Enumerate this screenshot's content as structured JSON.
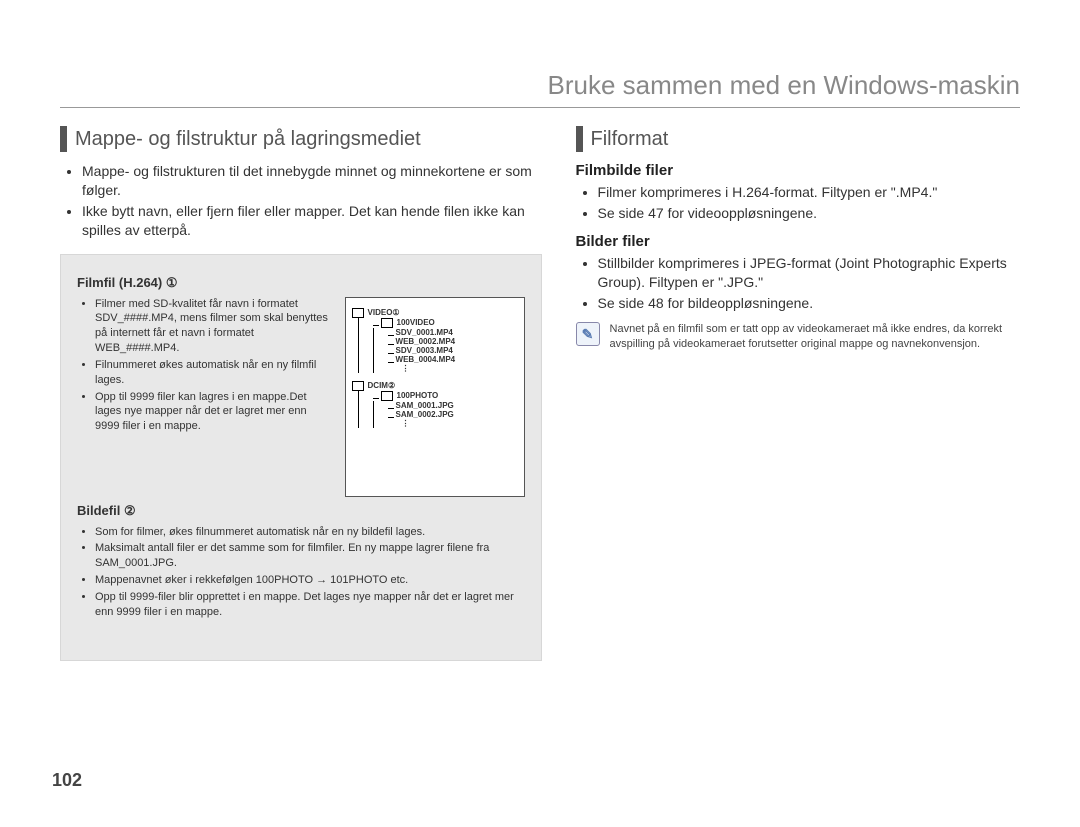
{
  "header": {
    "title": "Bruke sammen med en Windows-maskin"
  },
  "left": {
    "title": "Mappe- og filstruktur på lagringsmediet",
    "bullets": [
      "Mappe- og filstrukturen til det innebygde minnet og minnekortene er som følger.",
      "Ikke bytt navn, eller fjern filer eller mapper. Det kan hende filen ikke kan spilles av etterpå."
    ],
    "film": {
      "heading": "Filmfil (H.264) ①",
      "bullets": [
        "Filmer med SD-kvalitet får navn i formatet SDV_####.MP4, mens filmer som skal benyttes på internett får et navn i formatet WEB_####.MP4.",
        "Filnummeret økes automatisk når en ny filmfil lages.",
        "Opp til 9999 filer kan lagres i en mappe.Det lages nye mapper når det er lagret mer enn 9999 filer i en mappe."
      ]
    },
    "image": {
      "heading": "Bildefil ②",
      "bullets": [
        "Som for filmer, økes filnummeret automatisk når en ny bildefil lages.",
        "Maksimalt antall filer er det samme som for filmfiler. En ny mappe lagrer filene fra SAM_0001.JPG.",
        "Mappenavnet øker i rekkefølgen 100PHOTO → 101PHOTO etc.",
        "Opp til 9999-filer blir opprettet i en mappe. Det lages nye mapper når det er lagret mer enn 9999 filer i en mappe."
      ]
    },
    "tree": {
      "video": {
        "label": "VIDEO",
        "num": "①",
        "folder": "100VIDEO",
        "files": [
          "SDV_0001.MP4",
          "WEB_0002.MP4",
          "SDV_0003.MP4",
          "WEB_0004.MP4"
        ]
      },
      "dcim": {
        "label": "DCIM",
        "num": "②",
        "folder": "100PHOTO",
        "files": [
          "SAM_0001.JPG",
          "SAM_0002.JPG"
        ]
      }
    }
  },
  "right": {
    "title": "Filformat",
    "film": {
      "heading": "Filmbilde filer",
      "bullets": [
        "Filmer komprimeres i H.264-format. Filtypen er \".MP4.\"",
        "Se side 47 for videooppløsningene."
      ]
    },
    "image": {
      "heading": "Bilder filer",
      "bullets": [
        "Stillbilder komprimeres i JPEG-format (Joint Photographic Experts Group). Filtypen er \".JPG.\"",
        "Se side 48 for bildeoppløsningene."
      ]
    },
    "note": "Navnet på en filmfil som er tatt opp av videokameraet må ikke endres, da korrekt avspilling på videokameraet forutsetter original mappe og navnekonvensjon."
  },
  "page_number": "102"
}
